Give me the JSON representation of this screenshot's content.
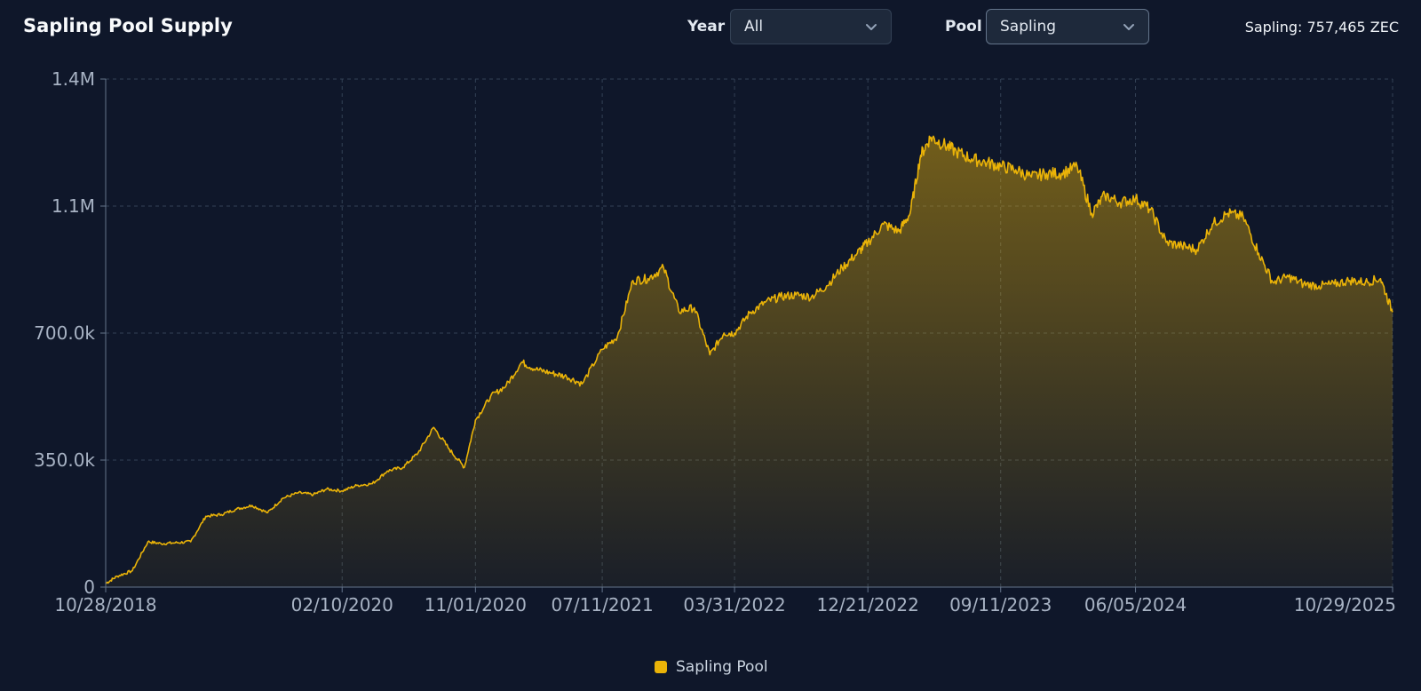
{
  "header": {
    "title": "Sapling Pool Supply",
    "year_label": "Year",
    "year_value": "All",
    "pool_label": "Pool",
    "pool_value": "Sapling",
    "status": "Sapling: 757,465 ZEC"
  },
  "colors": {
    "background": "#0f172a",
    "series": "#eab308",
    "grid": "#334155",
    "axis_text": "#a8b3c4"
  },
  "icons": {
    "dropdown": "chevron-down-icon"
  },
  "chart_data": {
    "type": "area",
    "title": "Sapling Pool Supply",
    "xlabel": "",
    "ylabel": "",
    "x_range": [
      "10/28/2018",
      "10/29/2025"
    ],
    "ylim": [
      0,
      1400000
    ],
    "y_ticks": [
      0,
      350000,
      700000,
      1050000,
      1400000
    ],
    "y_tick_labels": [
      "0",
      "350.0k",
      "700.0k",
      "1.1M",
      "1.4M"
    ],
    "x_ticks": [
      "10/28/2018",
      "02/10/2020",
      "11/01/2020",
      "07/11/2021",
      "03/31/2022",
      "12/21/2022",
      "09/11/2023",
      "06/05/2024",
      "10/29/2025"
    ],
    "grid": true,
    "legend": "bottom-center",
    "series": [
      {
        "name": "Sapling Pool",
        "color": "#eab308",
        "x": [
          "10/28/2018",
          "11/20/2018",
          "12/20/2018",
          "01/20/2019",
          "02/15/2019",
          "03/15/2019",
          "04/15/2019",
          "05/15/2019",
          "06/15/2019",
          "07/15/2019",
          "08/15/2019",
          "09/15/2019",
          "10/15/2019",
          "11/15/2019",
          "12/15/2019",
          "01/10/2020",
          "02/10/2020",
          "03/10/2020",
          "04/10/2020",
          "05/10/2020",
          "06/10/2020",
          "07/10/2020",
          "08/10/2020",
          "09/10/2020",
          "10/10/2020",
          "11/01/2020",
          "12/01/2020",
          "01/01/2021",
          "02/01/2021",
          "03/01/2021",
          "04/01/2021",
          "05/01/2021",
          "06/01/2021",
          "07/11/2021",
          "08/10/2021",
          "09/10/2021",
          "10/10/2021",
          "11/10/2021",
          "12/10/2021",
          "01/10/2022",
          "02/10/2022",
          "03/10/2022",
          "03/31/2022",
          "04/30/2022",
          "05/31/2022",
          "06/30/2022",
          "07/31/2022",
          "08/31/2022",
          "09/30/2022",
          "10/31/2022",
          "11/30/2022",
          "12/21/2022",
          "01/21/2023",
          "02/21/2023",
          "03/15/2023",
          "04/05/2023",
          "04/25/2023",
          "05/20/2023",
          "06/15/2023",
          "07/15/2023",
          "08/15/2023",
          "09/11/2023",
          "10/11/2023",
          "11/11/2023",
          "12/11/2023",
          "01/10/2024",
          "02/10/2024",
          "03/10/2024",
          "04/05/2024",
          "05/05/2024",
          "06/05/2024",
          "07/05/2024",
          "08/05/2024",
          "09/05/2024",
          "10/05/2024",
          "11/05/2024",
          "12/05/2024",
          "01/05/2025",
          "02/05/2025",
          "03/05/2025",
          "04/05/2025",
          "05/05/2025",
          "06/05/2025",
          "07/05/2025",
          "08/05/2025",
          "09/05/2025",
          "10/05/2025",
          "10/29/2025"
        ],
        "values": [
          10000,
          30000,
          45000,
          125000,
          120000,
          122000,
          125000,
          195000,
          200000,
          215000,
          225000,
          205000,
          245000,
          260000,
          255000,
          270000,
          265000,
          280000,
          285000,
          320000,
          330000,
          370000,
          440000,
          380000,
          330000,
          460000,
          525000,
          555000,
          620000,
          600000,
          590000,
          580000,
          560000,
          655000,
          690000,
          845000,
          850000,
          880000,
          760000,
          770000,
          640000,
          700000,
          700000,
          755000,
          785000,
          800000,
          805000,
          800000,
          830000,
          880000,
          920000,
          950000,
          1000000,
          980000,
          1030000,
          1190000,
          1240000,
          1220000,
          1200000,
          1180000,
          1170000,
          1160000,
          1150000,
          1130000,
          1140000,
          1140000,
          1160000,
          1030000,
          1080000,
          1060000,
          1070000,
          1040000,
          950000,
          940000,
          930000,
          1000000,
          1030000,
          1020000,
          920000,
          840000,
          855000,
          835000,
          830000,
          835000,
          845000,
          840000,
          850000,
          757465
        ]
      }
    ]
  },
  "legend": {
    "label": "Sapling Pool"
  }
}
